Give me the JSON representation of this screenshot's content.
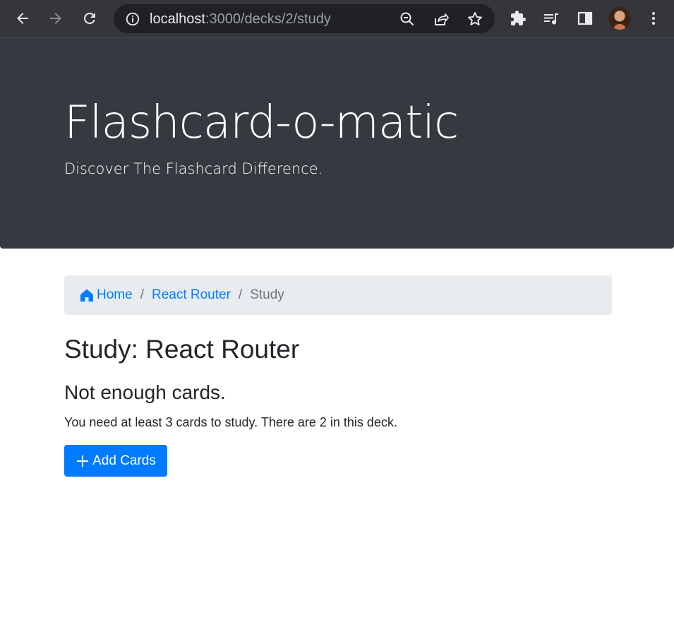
{
  "browser": {
    "url_host": "localhost",
    "url_path": ":3000/decks/2/study",
    "icons": [
      "back-icon",
      "forward-icon",
      "reload-icon",
      "site-info-icon",
      "zoom-icon",
      "share-icon",
      "bookmark-star-icon",
      "extensions-icon",
      "media-queue-icon",
      "side-panel-icon",
      "profile-avatar",
      "menu-kebab-icon"
    ]
  },
  "header": {
    "title": "Flashcard-o-matic",
    "lead": "Discover The Flashcard Difference."
  },
  "breadcrumb": {
    "home": "Home",
    "deck": "React Router",
    "current": "Study",
    "separator": "/"
  },
  "main": {
    "title": "Study: React Router",
    "subtitle": "Not enough cards.",
    "message": "You need at least 3 cards to study. There are 2 in this deck.",
    "add_button": "Add Cards"
  },
  "colors": {
    "chrome": "#35363a",
    "jumbotron": "#343a40",
    "primary": "#007bff",
    "breadcrumb_bg": "#e9ecef",
    "muted": "#6c757d"
  }
}
